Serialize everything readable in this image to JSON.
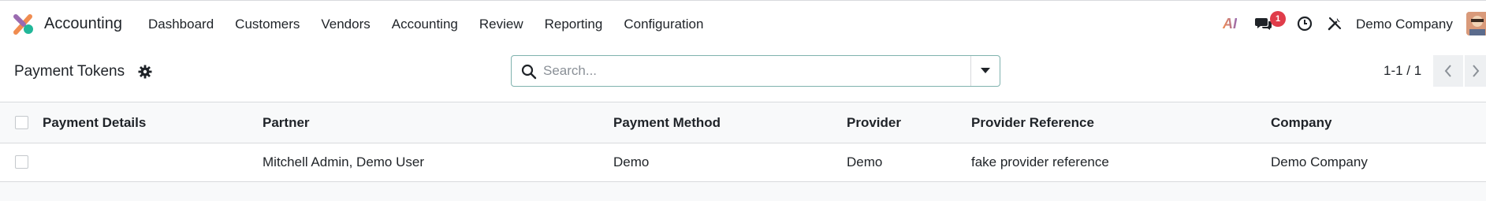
{
  "app": {
    "name": "Accounting"
  },
  "menu": [
    "Dashboard",
    "Customers",
    "Vendors",
    "Accounting",
    "Review",
    "Reporting",
    "Configuration"
  ],
  "systray": {
    "ai_label": "AI",
    "chat_badge": "1",
    "company": "Demo Company"
  },
  "control": {
    "title": "Payment Tokens",
    "search_placeholder": "Search...",
    "pager": "1-1 / 1"
  },
  "table": {
    "columns": [
      "Payment Details",
      "Partner",
      "Payment Method",
      "Provider",
      "Provider Reference",
      "Company"
    ],
    "rows": [
      {
        "payment_details": "",
        "partner": "Mitchell Admin, Demo User",
        "payment_method": "Demo",
        "provider": "Demo",
        "provider_reference": "fake provider reference",
        "company": "Demo Company"
      }
    ]
  },
  "colors": {
    "accent": "#017e84",
    "logo_orange": "#f08c50",
    "logo_green": "#21b799",
    "logo_purple": "#9a6bb0",
    "badge": "#e03c4a"
  },
  "icons": [
    "app-logo-icon",
    "ai-icon",
    "chat-icon",
    "clock-icon",
    "tools-icon",
    "gear-icon",
    "search-icon",
    "caret-down-icon",
    "chevron-left-icon",
    "chevron-right-icon"
  ]
}
